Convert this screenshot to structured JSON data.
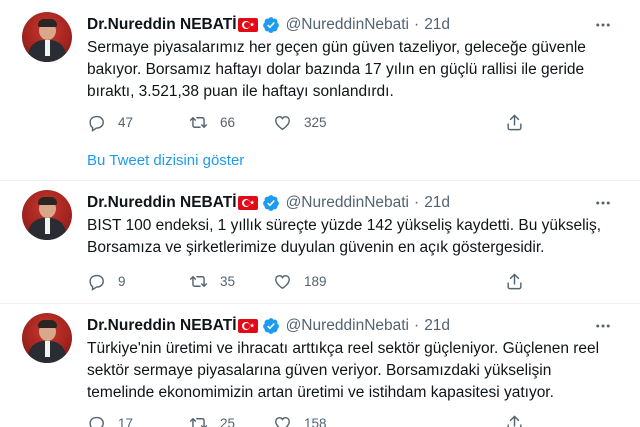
{
  "colors": {
    "accent": "#1d9bf0",
    "secondary_text": "#536471",
    "flag_red": "#e30a17"
  },
  "icons": {
    "reply": "speech-bubble",
    "retweet": "retweet-arrows",
    "like": "heart-outline",
    "share": "share-upload",
    "more": "three-dots",
    "verified": "blue-check-badge",
    "flag": "turkey-flag"
  },
  "tweets": [
    {
      "author_name": "Dr.Nureddin NEBATİ",
      "handle": "@NureddinNebati",
      "separator": "·",
      "time": "21d",
      "text": "Sermaye piyasalarımız her geçen gün güven tazeliyor, geleceğe güvenle bakıyor. Borsamız haftayı dolar bazında 17 yılın en güçlü rallisi ile geride bıraktı, 3.521,38 puan ile haftayı sonlandırdı.",
      "replies": "47",
      "retweets": "66",
      "likes": "325"
    },
    {
      "author_name": "Dr.Nureddin NEBATİ",
      "handle": "@NureddinNebati",
      "separator": "·",
      "time": "21d",
      "text": "BIST 100 endeksi, 1 yıllık süreçte yüzde 142 yükseliş kaydetti. Bu yükseliş, Borsamıza ve şirketlerimize duyulan güvenin en açık göstergesidir.",
      "replies": "9",
      "retweets": "35",
      "likes": "189"
    },
    {
      "author_name": "Dr.Nureddin NEBATİ",
      "handle": "@NureddinNebati",
      "separator": "·",
      "time": "21d",
      "text": "Türkiye'nin üretimi ve ihracatı arttıkça reel sektör güçleniyor. Güçlenen reel sektör sermaye piyasalarına güven veriyor. Borsamızdaki yükselişin temelinde ekonomimizin artan üretimi ve istihdam kapasitesi yatıyor.",
      "replies": "17",
      "retweets": "25",
      "likes": "158"
    }
  ],
  "show_thread_label": "Bu Tweet dizisini göster"
}
